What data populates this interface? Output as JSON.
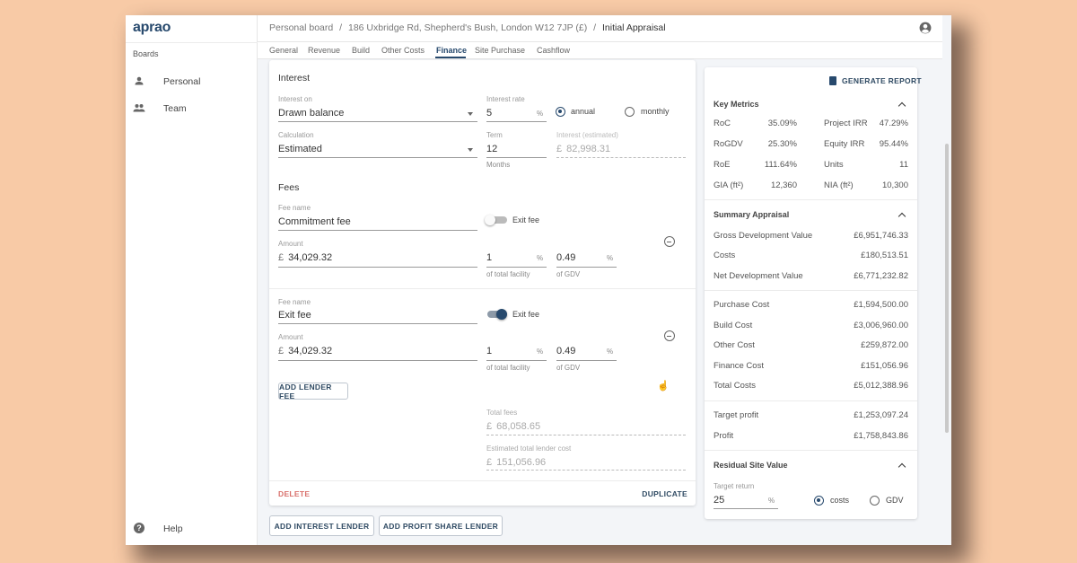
{
  "app": {
    "logo": "aprao",
    "brand_color": "#27496d",
    "background": "#f8caa6"
  },
  "sidebar": {
    "section": "Boards",
    "items": [
      {
        "label": "Personal",
        "icon": "person-icon"
      },
      {
        "label": "Team",
        "icon": "people-icon"
      }
    ],
    "help": "Help"
  },
  "header": {
    "breadcrumb": [
      "Personal board",
      "186 Uxbridge Rd, Shepherd's Bush, London W12 7JP (£)",
      "Initial Appraisal"
    ],
    "separator": "/"
  },
  "tabs": [
    {
      "label": "General"
    },
    {
      "label": "Revenue"
    },
    {
      "label": "Build"
    },
    {
      "label": "Other Costs"
    },
    {
      "label": "Finance",
      "active": true
    },
    {
      "label": "Site Purchase"
    },
    {
      "label": "Cashflow"
    }
  ],
  "lender": {
    "interest_heading": "Interest",
    "interest_on": {
      "label": "Interest on",
      "value": "Drawn balance"
    },
    "interest_rate": {
      "label": "Interest rate",
      "value": "5",
      "unit": "%"
    },
    "period": {
      "options": [
        "annual",
        "monthly"
      ],
      "selected": "annual"
    },
    "calculation": {
      "label": "Calculation",
      "value": "Estimated"
    },
    "term": {
      "label": "Term",
      "value": "12",
      "helper": "Months"
    },
    "interest_estimated": {
      "label": "Interest (estimated)",
      "currency": "£",
      "value": "82,998.31"
    },
    "fees_heading": "Fees",
    "fees": [
      {
        "name_label": "Fee name",
        "name": "Commitment fee",
        "exit_label": "Exit fee",
        "exit_fee": false,
        "amount_label": "Amount",
        "currency": "£",
        "amount": "34,029.32",
        "pct_facility": "1",
        "pct_facility_helper": "of total facility",
        "pct_gdv": "0.49",
        "pct_gdv_helper": "of GDV",
        "unit": "%"
      },
      {
        "name_label": "Fee name",
        "name": "Exit fee",
        "exit_label": "Exit fee",
        "exit_fee": true,
        "amount_label": "Amount",
        "currency": "£",
        "amount": "34,029.32",
        "pct_facility": "1",
        "pct_facility_helper": "of total facility",
        "pct_gdv": "0.49",
        "pct_gdv_helper": "of GDV",
        "unit": "%"
      }
    ],
    "add_fee": "ADD LENDER FEE",
    "total_fees": {
      "label": "Total fees",
      "currency": "£",
      "value": "68,058.65"
    },
    "total_lender_cost": {
      "label": "Estimated total lender cost",
      "currency": "£",
      "value": "151,056.96"
    },
    "delete": "DELETE",
    "duplicate": "DUPLICATE"
  },
  "actions": {
    "add_interest": "ADD INTEREST LENDER",
    "add_profit_share": "ADD PROFIT SHARE LENDER"
  },
  "summary": {
    "generate_report": "GENERATE REPORT",
    "key_metrics": {
      "title": "Key Metrics",
      "rows": [
        [
          "RoC",
          "35.09%",
          "Project IRR",
          "47.29%"
        ],
        [
          "RoGDV",
          "25.30%",
          "Equity IRR",
          "95.44%"
        ],
        [
          "RoE",
          "111.64%",
          "Units",
          "11"
        ],
        [
          "GIA (ft²)",
          "12,360",
          "NIA (ft²)",
          "10,300"
        ]
      ]
    },
    "appraisal": {
      "title": "Summary Appraisal",
      "group1": [
        [
          "Gross Development Value",
          "£6,951,746.33"
        ],
        [
          "Costs",
          "£180,513.51"
        ],
        [
          "Net Development Value",
          "£6,771,232.82"
        ]
      ],
      "group2": [
        [
          "Purchase Cost",
          "£1,594,500.00"
        ],
        [
          "Build Cost",
          "£3,006,960.00"
        ],
        [
          "Other Cost",
          "£259,872.00"
        ],
        [
          "Finance Cost",
          "£151,056.96"
        ],
        [
          "Total Costs",
          "£5,012,388.96"
        ]
      ],
      "group3": [
        [
          "Target profit",
          "£1,253,097.24"
        ],
        [
          "Profit",
          "£1,758,843.86"
        ]
      ]
    },
    "residual": {
      "title": "Residual Site Value",
      "target_label": "Target return",
      "target_value": "25",
      "unit": "%",
      "options": [
        "costs",
        "GDV"
      ],
      "selected": "costs"
    }
  }
}
